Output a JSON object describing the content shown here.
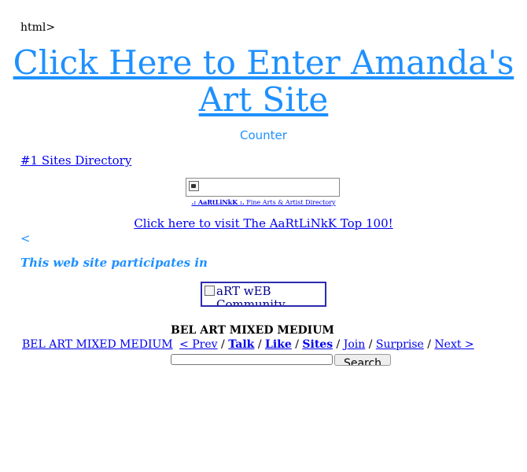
{
  "stray_text": "html>",
  "main_link": "Click Here to Enter Amanda's Art Site",
  "counter": "Counter",
  "directory_link": "#1 Sites Directory",
  "banner": {
    "caption_bold": ".: AaRtLiNkK :.",
    "caption_rest": " Fine Arts & Artist Directory"
  },
  "top100_link": "Click here to visit The AaRtLiNkK Top 100!",
  "lt_text": "<",
  "participates_text": "This web site participates in",
  "ring_widget": {
    "text": "aRT wEB Community"
  },
  "webring": {
    "title": "BEL ART MIXED MEDIUM",
    "name_link": "BEL ART MIXED MEDIUM",
    "prev": "< Prev",
    "talk": "Talk",
    "like": "Like",
    "sites": "Sites",
    "join": "Join",
    "surprise": "Surprise",
    "next": "Next >",
    "separator": "/",
    "search_button": "Search"
  }
}
